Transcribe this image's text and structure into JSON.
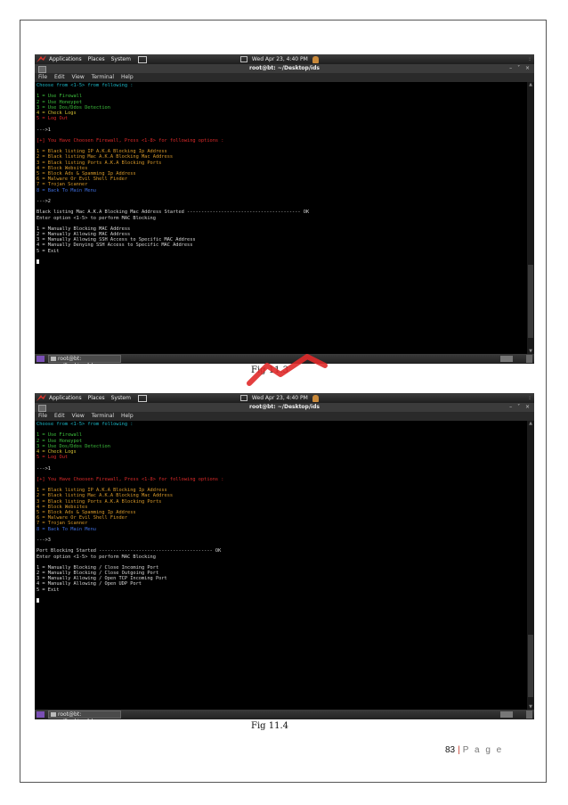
{
  "desktop": {
    "menus": [
      "Applications",
      "Places",
      "System"
    ],
    "clock": "Wed Apr 23, 4:40 PM",
    "window_title": "root@bt: ~/Desktop/ids",
    "terminal_menu": [
      "File",
      "Edit",
      "View",
      "Terminal",
      "Help"
    ],
    "task_item": "root@bt: ~/Desktop/ids"
  },
  "colors": {
    "terminal_bg": "#000000",
    "cyan": "#1ab8c8",
    "green": "#3ec23e",
    "yellow": "#d6c233",
    "red": "#e02a2a",
    "orange": "#d99a2a",
    "blue": "#3f6fe0",
    "white": "#d8d8d8"
  },
  "icons": [
    "backtrack-dragon-icon",
    "terminal-launcher-icon",
    "mail-icon",
    "user-avatar-icon",
    "window-close-icon"
  ],
  "screens": [
    {
      "caption": "Fig 11.3",
      "lines": [
        {
          "t": "Choose from <1-5> from following :",
          "c": "cyan"
        },
        {
          "t": "",
          "c": "white"
        },
        {
          "t": "1 = Use Firewall",
          "c": "green"
        },
        {
          "t": "2 = Use Honeypot",
          "c": "green"
        },
        {
          "t": "3 = Use Dos/Ddos Detection",
          "c": "green"
        },
        {
          "t": "4 = Check Logs",
          "c": "yellow"
        },
        {
          "t": "5 = Log Out",
          "c": "red"
        },
        {
          "t": "",
          "c": "white"
        },
        {
          "t": "--->1",
          "c": "white"
        },
        {
          "t": "",
          "c": "white"
        },
        {
          "t": "[+] You Have Choosen Firewall, Press <1-8> for following options :",
          "c": "red"
        },
        {
          "t": "",
          "c": "white"
        },
        {
          "t": "1 = Black listing IP A.K.A Blocking Ip Address",
          "c": "orange"
        },
        {
          "t": "2 = Black listing Mac A.K.A Blocking Mac Address",
          "c": "orange"
        },
        {
          "t": "3 = Black listing Ports A.K.A Blocking Ports",
          "c": "orange"
        },
        {
          "t": "4 = Block Websites",
          "c": "orange"
        },
        {
          "t": "5 = Block Ads & Spamming Ip Address",
          "c": "orange"
        },
        {
          "t": "6 = Malware Or Evil Shell Finder",
          "c": "orange"
        },
        {
          "t": "7 = Trojan Scanner",
          "c": "orange"
        },
        {
          "t": "8 = Back To Main Menu",
          "c": "blue"
        },
        {
          "t": "",
          "c": "white"
        },
        {
          "t": "--->2",
          "c": "white"
        },
        {
          "t": "",
          "c": "white"
        },
        {
          "t": "Black listing Mac A.K.A Blocking Mac Address Started ---------------------------------------- OK",
          "c": "white"
        },
        {
          "t": "Enter option <1-5> to perform MAC Blocking",
          "c": "white"
        },
        {
          "t": "",
          "c": "white"
        },
        {
          "t": "1 = Manually Blocking MAC Address",
          "c": "white"
        },
        {
          "t": "2 = Manually Allowing MAC Address",
          "c": "white"
        },
        {
          "t": "3 = Manually Allowing SSH Access to Specific MAC Address",
          "c": "white"
        },
        {
          "t": "4 = Manually Denying SSH Access to Specific MAC Address",
          "c": "white"
        },
        {
          "t": "5 = Exit",
          "c": "white"
        }
      ]
    },
    {
      "caption": "Fig 11.4",
      "lines": [
        {
          "t": "Choose from <1-5> from following :",
          "c": "cyan"
        },
        {
          "t": "",
          "c": "white"
        },
        {
          "t": "1 = Use Firewall",
          "c": "green"
        },
        {
          "t": "2 = Use Honeypot",
          "c": "green"
        },
        {
          "t": "3 = Use Dos/Ddos Detection",
          "c": "green"
        },
        {
          "t": "4 = Check Logs",
          "c": "yellow"
        },
        {
          "t": "5 = Log Out",
          "c": "red"
        },
        {
          "t": "",
          "c": "white"
        },
        {
          "t": "--->1",
          "c": "white"
        },
        {
          "t": "",
          "c": "white"
        },
        {
          "t": "[+] You Have Choosen Firewall, Press <1-8> for following options :",
          "c": "red"
        },
        {
          "t": "",
          "c": "white"
        },
        {
          "t": "1 = Black listing IP A.K.A Blocking Ip Address",
          "c": "orange"
        },
        {
          "t": "2 = Black listing Mac A.K.A Blocking Mac Address",
          "c": "orange"
        },
        {
          "t": "3 = Black listing Ports A.K.A Blocking Ports",
          "c": "orange"
        },
        {
          "t": "4 = Block Websites",
          "c": "orange"
        },
        {
          "t": "5 = Block Ads & Spamming Ip Address",
          "c": "orange"
        },
        {
          "t": "6 = Malware Or Evil Shell Finder",
          "c": "orange"
        },
        {
          "t": "7 = Trojan Scanner",
          "c": "orange"
        },
        {
          "t": "8 = Back To Main Menu",
          "c": "blue"
        },
        {
          "t": "",
          "c": "white"
        },
        {
          "t": "--->3",
          "c": "white"
        },
        {
          "t": "",
          "c": "white"
        },
        {
          "t": "Port Blocking Started ---------------------------------------- OK",
          "c": "white"
        },
        {
          "t": "Enter option <1-5> to perform MAC Blocking",
          "c": "white"
        },
        {
          "t": "",
          "c": "white"
        },
        {
          "t": "1 = Manually Blocking / Close Incoming Port",
          "c": "white"
        },
        {
          "t": "2 = Manually Blocking / Close Outgoing Port",
          "c": "white"
        },
        {
          "t": "3 = Manually Allowing / Open TCP Incoming Port",
          "c": "white"
        },
        {
          "t": "4 = Manually Allowing / Open UDP Port",
          "c": "white"
        },
        {
          "t": "5 = Exit",
          "c": "white"
        }
      ]
    }
  ],
  "footer": {
    "page_number": "83",
    "separator": "|",
    "page_label": "P a g e"
  }
}
